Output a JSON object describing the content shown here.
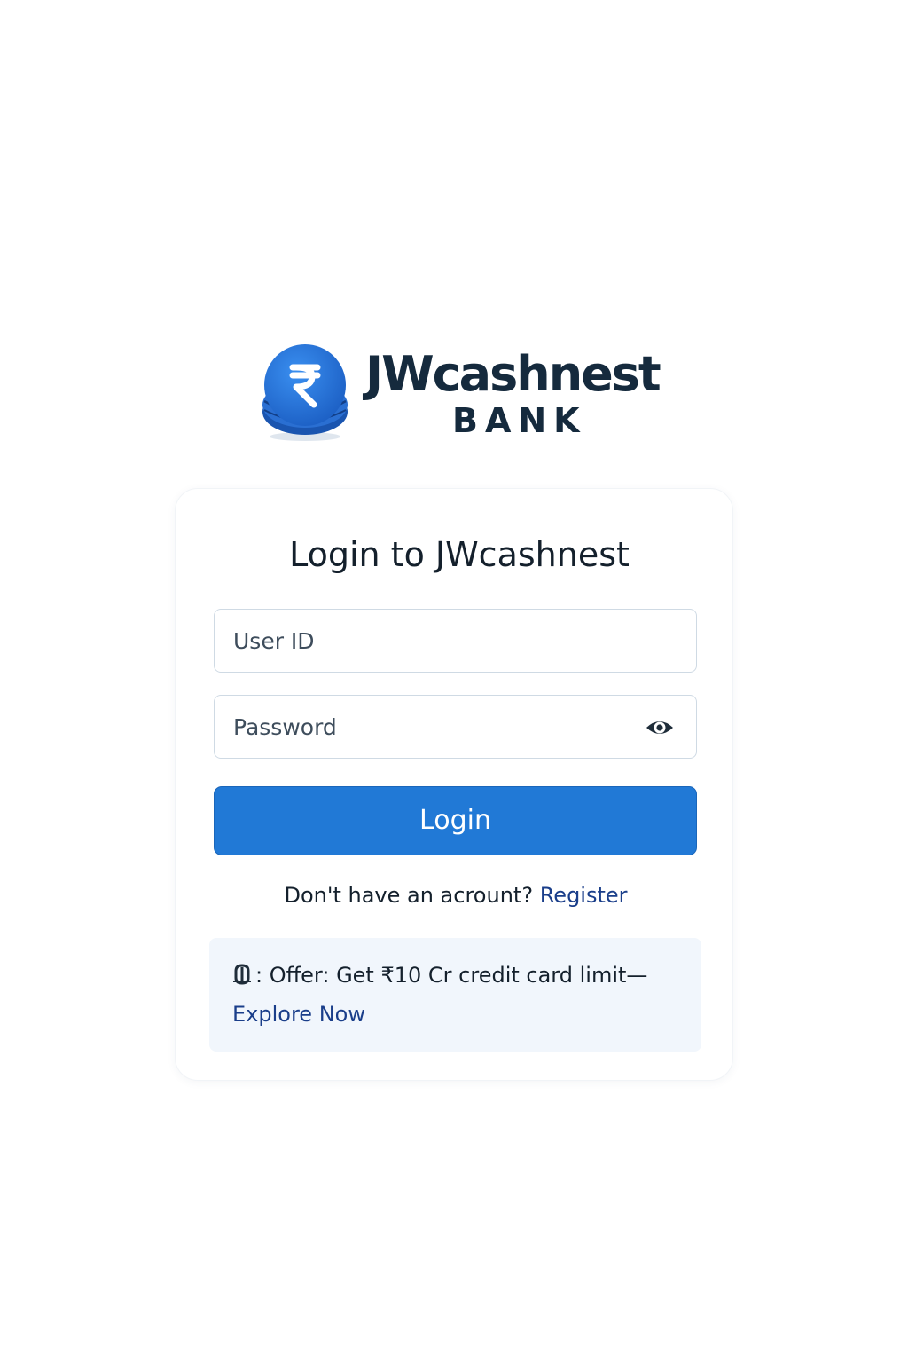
{
  "brand": {
    "name": "JWcashnest",
    "subtitle": "BANK",
    "logo_icon": "rupee-coin-icon",
    "colors": {
      "primary": "#2179d6",
      "text_dark": "#152a3d",
      "link": "#1a3e8a",
      "offer_bg": "#f1f6fc"
    }
  },
  "login_card": {
    "title": "Login to JWcashnest",
    "user_id": {
      "value": "",
      "placeholder": "User ID"
    },
    "password": {
      "value": "",
      "placeholder": "Password",
      "toggle_icon": "eye-icon"
    },
    "login_button_label": "Login",
    "register_prompt": "Don't have an acrount?",
    "register_link_label": "Register"
  },
  "offer": {
    "icon": "offer-icon",
    "text": ": Offer: Get ₹10 Cr credit card limit—",
    "link_label": "Explore Now"
  }
}
